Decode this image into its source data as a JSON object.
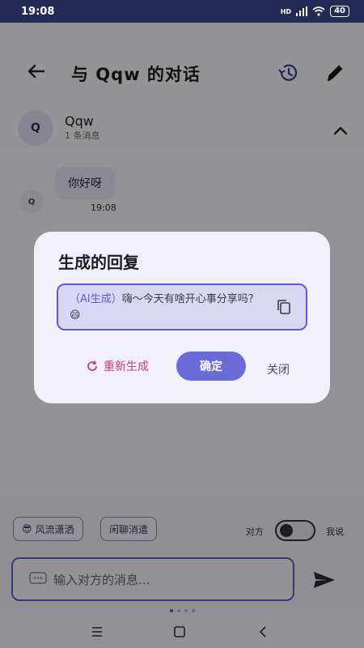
{
  "status_bar": {
    "time": "19:08",
    "signal": "HD",
    "battery": "40"
  },
  "header": {
    "title": "与 Qqw 的对话"
  },
  "contact": {
    "avatar_letter": "Q",
    "name": "Qqw",
    "message_count": "1 条消息"
  },
  "chat": {
    "messages": [
      {
        "avatar": "Q",
        "text": "你好呀",
        "time": "19:08"
      }
    ]
  },
  "dialog": {
    "title": "生成的回复",
    "ai_tag": "（AI生成）",
    "reply": "嗨～今天有啥开心事分享吗？😄",
    "regenerate_label": "重新生成",
    "confirm_label": "确定",
    "close_label": "关闭"
  },
  "bottom": {
    "chips": [
      {
        "emoji": "😎",
        "label": "风流潇洒"
      },
      {
        "label": "闲聊消遣"
      }
    ],
    "toggle_left_label": "对方",
    "toggle_right_label": "我说",
    "input_placeholder": "输入对方的消息..."
  },
  "colors": {
    "accent": "#5d5ad5",
    "regen": "#c0436e",
    "status_bar": "#222a55"
  }
}
